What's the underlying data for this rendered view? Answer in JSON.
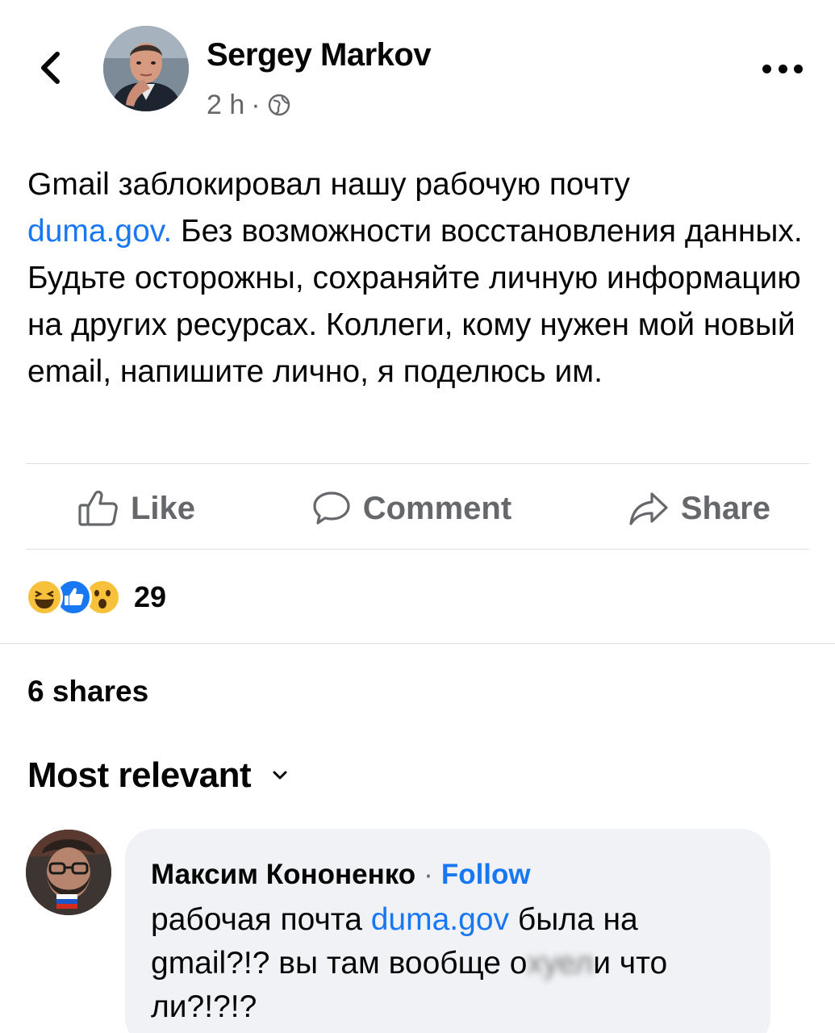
{
  "post": {
    "author": "Sergey Markov",
    "time": "2 h",
    "meta_separator": "·",
    "text_line1": "Gmail заблокировал нашу рабочую почту",
    "link": "duma.gov.",
    "text_after_link": " Без возможности восстановления",
    "text_rest": "данных. Будьте осторожны, сохраняйте личную информацию на других ресурсах. Коллеги, кому нужен мой новый email, напишите лично, я поделюсь им."
  },
  "actions": {
    "like": "Like",
    "comment": "Comment",
    "share": "Share"
  },
  "reactions": {
    "count": "29",
    "types": [
      "haha-icon",
      "like-icon",
      "wow-icon"
    ]
  },
  "shares": "6 shares",
  "sort_label": "Most relevant",
  "comment": {
    "author": "Максим Кононенко",
    "separator": "·",
    "follow": "Follow",
    "text_before_link": "рабочая почта ",
    "link": "duma.gov",
    "text_middle": " была на gmail?!? вы там вообще о",
    "blurred": "хуел",
    "text_end": "и что ли?!?!?"
  },
  "colors": {
    "link": "#1877f2",
    "secondary_text": "#65676b",
    "bubble": "#f0f2f5",
    "divider": "#dadde1"
  }
}
